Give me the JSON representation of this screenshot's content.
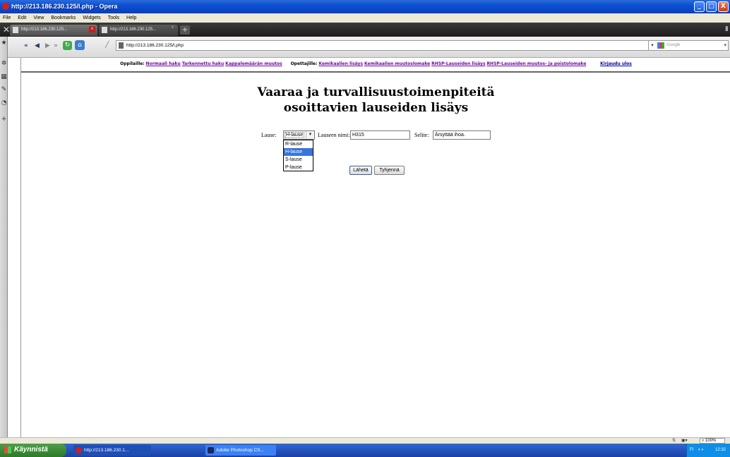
{
  "window": {
    "title": "http://213.186.230.125/l.php - Opera",
    "controls": [
      "_",
      "□",
      "X"
    ]
  },
  "menu": [
    "File",
    "Edit",
    "View",
    "Bookmarks",
    "Widgets",
    "Tools",
    "Help"
  ],
  "tabs": [
    {
      "label": "http://213.186.230.125...",
      "close": "x",
      "active": true
    },
    {
      "label": "http://213.186.230.125...",
      "close": "x",
      "active": false
    }
  ],
  "newtab_icon": "+",
  "address": {
    "url": "http://213.186.230.125/l.php",
    "search_placeholder": "Google"
  },
  "nav": {
    "students_label": "Oppilaille:",
    "students_links": [
      "Normaali haku",
      "Tarkennettu haku",
      "Kappalemäärän muutos"
    ],
    "teachers_label": "Opettajille:",
    "teachers_links": [
      "Kemikaalien lisäys",
      "Kemikaalien muutoslomake",
      "RHSP-Lauseiden lisäys",
      "RHSP-Lauseiden muutos- ja poistolomake"
    ],
    "logout": "Kirjaudu ulos"
  },
  "page": {
    "heading_line1": "Vaaraa ja turvallisuustoimenpiteitä",
    "heading_line2": "osoittavien lauseiden lisäys"
  },
  "form": {
    "type_label": "Lause:",
    "type_value": "H-lause",
    "name_label": "Lauseen nimi:",
    "name_value": "H315",
    "desc_label": "Selite:",
    "desc_value": "Ärsyttää ihoa.",
    "options": [
      "R-lause",
      "H-lause",
      "S-lause",
      "P-lause"
    ],
    "selected_index": 1,
    "submit": "Lähetä",
    "reset": "Tyhjennä"
  },
  "status": {
    "zoom": "100%"
  },
  "taskbar": {
    "start": "Käynnistä",
    "items": [
      "http://213.186.230.1...",
      "Adobe Photoshop CS..."
    ],
    "lang": "FI",
    "clock": "12:32"
  },
  "colors": {
    "titlebar": "#0b4fd4",
    "link": "#00009a",
    "visited_link": "#6a0a9a",
    "selection": "#3875d7",
    "taskbar": "#245edb",
    "start": "#3c8c3a"
  },
  "icons": [
    "opera-icon",
    "tools-icon",
    "back-icon",
    "forward-icon",
    "reload-icon",
    "home-icon",
    "wand-icon",
    "page-icon",
    "google-icon",
    "bookmarks-icon",
    "widgets-icon",
    "notes-icon",
    "history-icon"
  ]
}
